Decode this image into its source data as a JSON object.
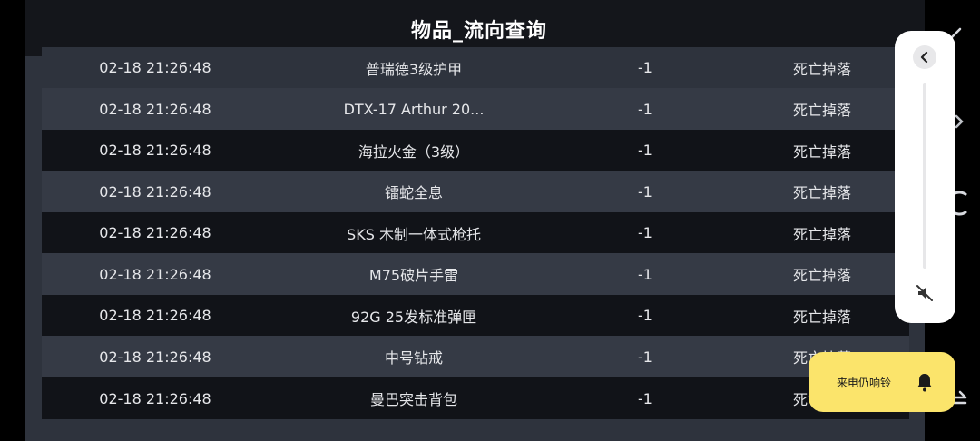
{
  "header": {
    "title": "物品_流向查询"
  },
  "table": {
    "rows": [
      {
        "time": "02-18 21:26:48",
        "item": "普瑞德3级护甲",
        "qty": "-1",
        "source": "死亡掉落"
      },
      {
        "time": "02-18 21:26:48",
        "item": "DTX-17 Arthur 20...",
        "qty": "-1",
        "source": "死亡掉落"
      },
      {
        "time": "02-18 21:26:48",
        "item": "海拉火金（3级）",
        "qty": "-1",
        "source": "死亡掉落"
      },
      {
        "time": "02-18 21:26:48",
        "item": "镭蛇全息",
        "qty": "-1",
        "source": "死亡掉落"
      },
      {
        "time": "02-18 21:26:48",
        "item": "SKS 木制一体式枪托",
        "qty": "-1",
        "source": "死亡掉落"
      },
      {
        "time": "02-18 21:26:48",
        "item": "M75破片手雷",
        "qty": "-1",
        "source": "死亡掉落"
      },
      {
        "time": "02-18 21:26:48",
        "item": "92G 25发标准弹匣",
        "qty": "-1",
        "source": "死亡掉落"
      },
      {
        "time": "02-18 21:26:48",
        "item": "中号钻戒",
        "qty": "-1",
        "source": "死亡掉落"
      },
      {
        "time": "02-18 21:26:48",
        "item": "曼巴突击背包",
        "qty": "-1",
        "source": "死亡掉落"
      }
    ]
  },
  "volume_panel": {
    "back_icon": "chevron-left-icon",
    "mute_icon": "volume-muted-icon"
  },
  "call_toast": {
    "text": "来电仍响铃",
    "icon": "bell-icon"
  },
  "colors": {
    "panel": "#2e333d",
    "row_dark": "#111318",
    "row_light": "#353a45",
    "toast": "#fbe46b"
  }
}
